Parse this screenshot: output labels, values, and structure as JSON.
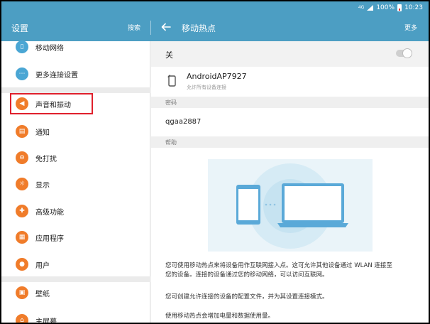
{
  "status_bar": {
    "signal": "4G",
    "battery": "100%",
    "time": "10:23"
  },
  "app_bar": {
    "title": "设置",
    "search_label": "搜索",
    "subtitle": "移动热点",
    "more_label": "更多"
  },
  "sidebar": {
    "items": [
      {
        "label": "移动网络",
        "icon": "mobile-network-icon",
        "color": "#4aa6d4"
      },
      {
        "label": "更多连接设置",
        "icon": "more-connections-icon",
        "color": "#4aa6d4"
      },
      {
        "label": "声音和振动",
        "icon": "sound-icon",
        "color": "#f07c2a"
      },
      {
        "label": "通知",
        "icon": "notification-icon",
        "color": "#f07c2a"
      },
      {
        "label": "免打扰",
        "icon": "do-not-disturb-icon",
        "color": "#f07c2a"
      },
      {
        "label": "显示",
        "icon": "display-icon",
        "color": "#f07c2a"
      },
      {
        "label": "高级功能",
        "icon": "advanced-features-icon",
        "color": "#f07c2a"
      },
      {
        "label": "应用程序",
        "icon": "apps-icon",
        "color": "#f07c2a"
      },
      {
        "label": "用户",
        "icon": "users-icon",
        "color": "#f07c2a"
      },
      {
        "label": "壁纸",
        "icon": "wallpaper-icon",
        "color": "#f07c2a"
      },
      {
        "label": "主屏幕",
        "icon": "home-screen-icon",
        "color": "#f07c2a"
      }
    ]
  },
  "hotspot": {
    "toggle_label": "关",
    "toggle_on": false,
    "network_name": "AndroidAP7927",
    "network_desc": "允许所有设备连接",
    "password_header": "密码",
    "password": "qgaa2887",
    "help_header": "帮助",
    "help_p1_line1": "您可使用移动热点来将设备用作互联网接入点。这可允许其他设备通过 WLAN 连接至",
    "help_p1_line2": "您的设备。连接的设备通过您的移动网络，可以访问互联网。",
    "help_p2": "您可创建允许连接的设备的配置文件，并为其设置连接模式。",
    "help_p3": "使用移动热点会增加电量和数据使用量。"
  },
  "colors": {
    "accent": "#4c9ec3",
    "highlight": "#e0202c"
  }
}
